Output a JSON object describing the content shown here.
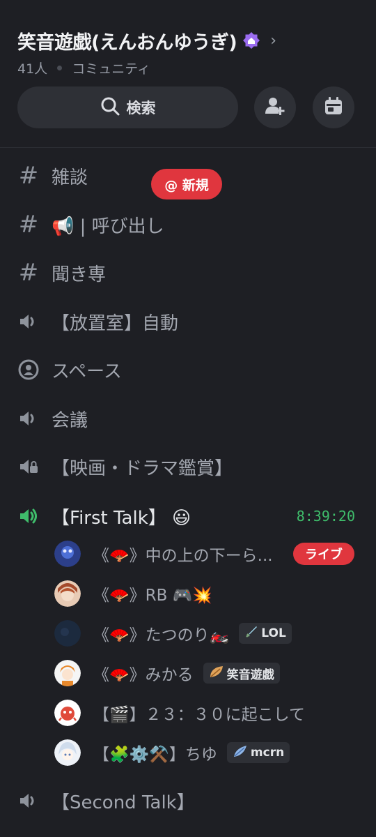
{
  "server": {
    "name": "笑音遊戯(えんおんゆうぎ)",
    "members": "41人",
    "type": "コミュニティ"
  },
  "search": {
    "label": "検索"
  },
  "channels": [
    {
      "name": "雑談",
      "kind": "text",
      "badge": "@ 新規"
    },
    {
      "name": "📢 | 呼び出し",
      "kind": "text"
    },
    {
      "name": "聞き専",
      "kind": "text"
    },
    {
      "name": "【放置室】自動",
      "kind": "voice"
    },
    {
      "name": "スペース",
      "kind": "stage"
    },
    {
      "name": "会議",
      "kind": "voice"
    },
    {
      "name": "【映画・ドラマ鑑賞】",
      "kind": "voice-locked"
    },
    {
      "name": "【First Talk】 😃",
      "kind": "voice-active",
      "timer": "8:39:20"
    },
    {
      "name": "【Second Talk】",
      "kind": "voice"
    }
  ],
  "voice_members": [
    {
      "name": "《🪭》中の上の下ーら...",
      "badge": "ライブ"
    },
    {
      "name": "《🪭》RB 🎮💥"
    },
    {
      "name": "《🪭》たつのり🏍️",
      "tag": "LOL",
      "tag_icon": "sword-icon"
    },
    {
      "name": "《🪭》みかる",
      "tag": "笑音遊戯",
      "tag_icon": "leaf-icon"
    },
    {
      "name": "【🎬】２３：３０に起こして"
    },
    {
      "name": "【🧩⚙️⚒️】ちゆ",
      "tag": "mcrn",
      "tag_icon": "feather-icon"
    }
  ],
  "colors": {
    "background": "#1e1f24",
    "live_red": "#e0363e",
    "active_green": "#3fbd6b",
    "boost_purple": "#9b6cf0"
  }
}
